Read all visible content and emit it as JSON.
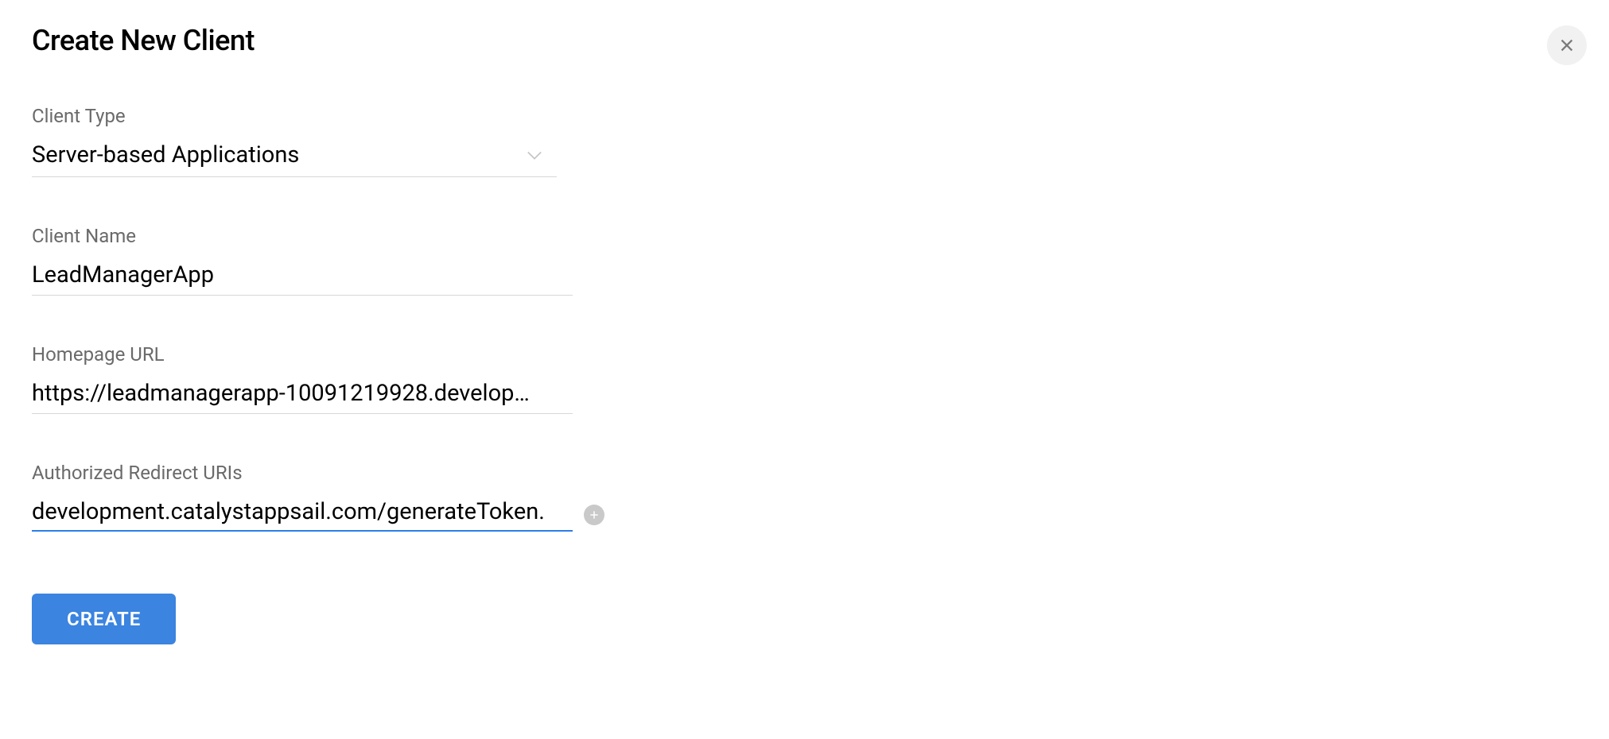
{
  "title": "Create New Client",
  "fields": {
    "clientType": {
      "label": "Client Type",
      "value": "Server-based Applications"
    },
    "clientName": {
      "label": "Client Name",
      "value": "LeadManagerApp"
    },
    "homepageUrl": {
      "label": "Homepage URL",
      "value": "https://leadmanagerapp-10091219928.develop…"
    },
    "redirectUris": {
      "label": "Authorized Redirect URIs",
      "value": ".development.catalystappsail.com/generateToken"
    }
  },
  "buttons": {
    "create": "CREATE"
  }
}
